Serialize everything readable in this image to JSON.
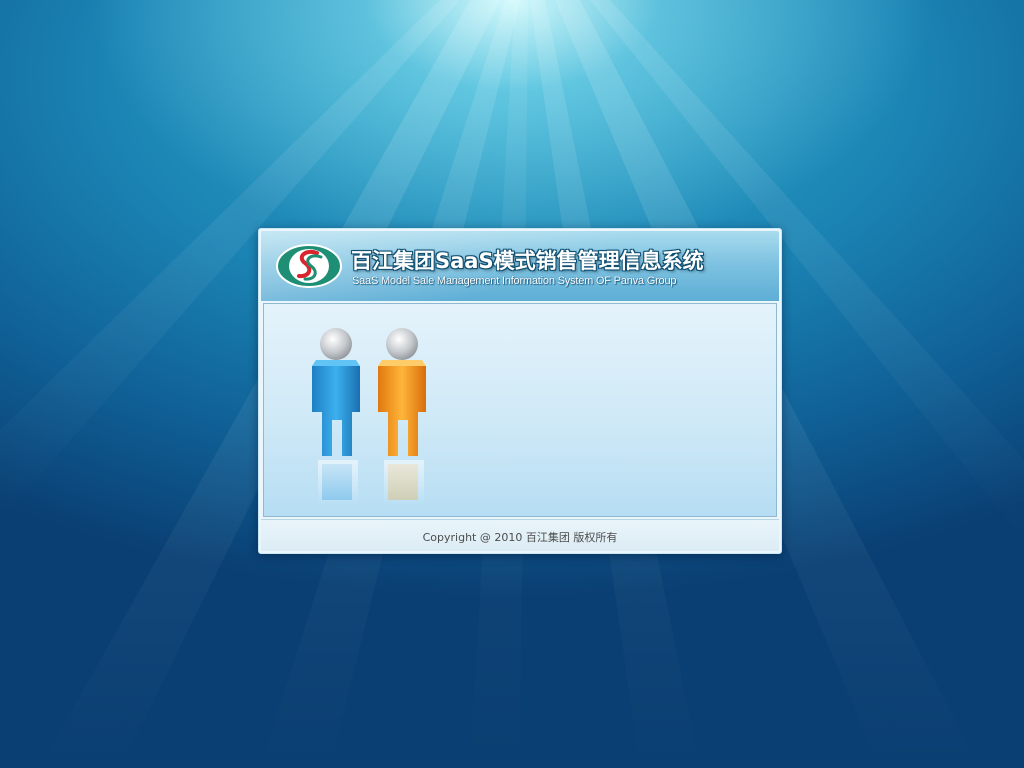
{
  "header": {
    "title_cn": "百江集团SaaS模式销售管理信息系统",
    "title_en": "SaaS Model Sale  Management Information System OF Panva Group",
    "logo_icon": "panva-s-logo-icon"
  },
  "content": {
    "illustration_icon": "two-users-icon",
    "figure_colors": {
      "left_person": "#2b9be0",
      "right_person": "#f5a11e"
    }
  },
  "footer": {
    "copyright": "Copyright @ 2010  百江集团  版权所有"
  },
  "colors": {
    "background": "#1b84b4",
    "header": "#7fc3e1",
    "content": "#cfe9f7",
    "logo_green": "#1e8f75",
    "logo_red": "#d9262c"
  }
}
